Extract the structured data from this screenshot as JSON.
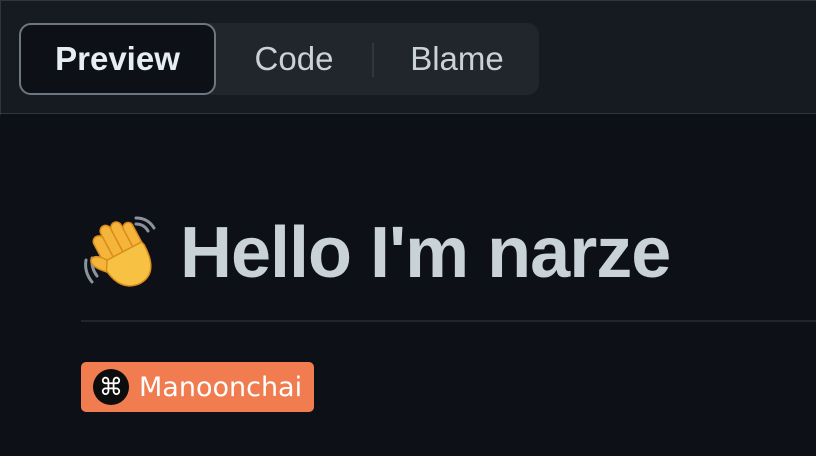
{
  "tabs": {
    "preview_label": "Preview",
    "code_label": "Code",
    "blame_label": "Blame",
    "selected": "Preview"
  },
  "readme": {
    "heading_emoji": "waving-hand-icon",
    "heading_text": "Hello I'm narze"
  },
  "badge": {
    "icon": "command-key-icon",
    "icon_glyph": "⌘",
    "label": "Manoonchai",
    "color": "#f07c50"
  },
  "colors": {
    "background": "#0d1117",
    "header_background": "#161b22",
    "text": "#c9d1d9"
  }
}
